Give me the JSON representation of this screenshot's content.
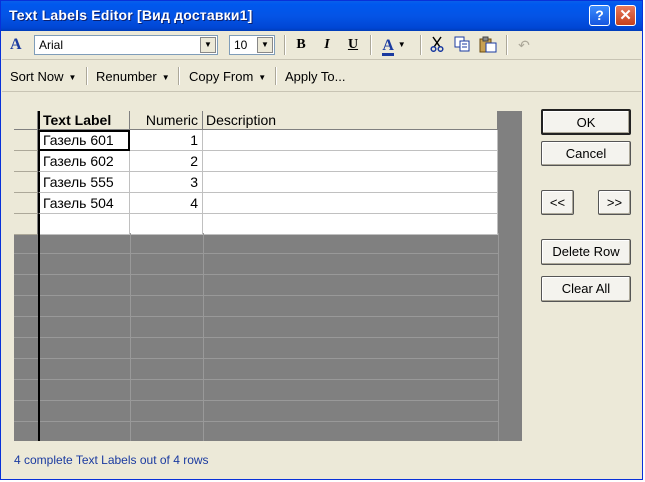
{
  "window": {
    "title": "Text Labels Editor [Вид доставки1]",
    "help_glyph": "?",
    "close_glyph": "✕"
  },
  "toolbar": {
    "font_icon": "A",
    "font_name": "Arial",
    "font_size": "10",
    "bold": "B",
    "italic": "I",
    "underline": "U",
    "color_icon": "A",
    "icons": [
      "cut-icon",
      "copy-icon",
      "paste-icon",
      "undo-icon"
    ],
    "accent_color": "#1a3aa0"
  },
  "menu": {
    "sort_now": "Sort Now",
    "renumber": "Renumber",
    "copy_from": "Copy From",
    "apply_to": "Apply To..."
  },
  "grid": {
    "columns": [
      "Text Label",
      "Numeric",
      "Description"
    ],
    "rows": [
      {
        "label": "Газель 601",
        "numeric": "1",
        "description": ""
      },
      {
        "label": "Газель 602",
        "numeric": "2",
        "description": ""
      },
      {
        "label": "Газель 555",
        "numeric": "3",
        "description": ""
      },
      {
        "label": "Газель 504",
        "numeric": "4",
        "description": ""
      },
      {
        "label": "",
        "numeric": "",
        "description": ""
      }
    ]
  },
  "buttons": {
    "ok": "OK",
    "cancel": "Cancel",
    "prev": "<<",
    "next": ">>",
    "delete_row": "Delete Row",
    "clear_all": "Clear All"
  },
  "status": "4 complete Text Labels out of 4 rows"
}
